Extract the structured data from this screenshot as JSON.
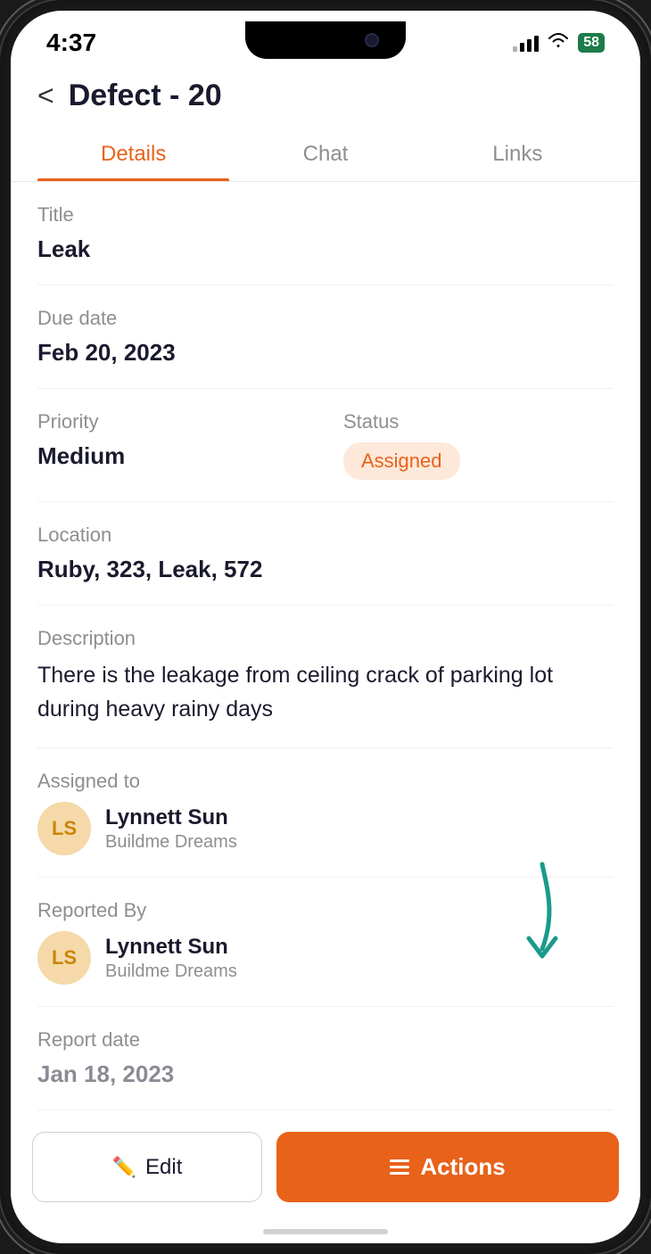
{
  "status_bar": {
    "time": "4:37",
    "battery": "58",
    "signal_bars": [
      6,
      10,
      14,
      18
    ],
    "signal_active": [
      false,
      true,
      true,
      true
    ]
  },
  "header": {
    "back_label": "<",
    "title": "Defect - 20"
  },
  "tabs": [
    {
      "id": "details",
      "label": "Details",
      "active": true
    },
    {
      "id": "chat",
      "label": "Chat",
      "active": false
    },
    {
      "id": "links",
      "label": "Links",
      "active": false
    }
  ],
  "fields": {
    "title_label": "Title",
    "title_value": "Leak",
    "due_date_label": "Due date",
    "due_date_value": "Feb 20, 2023",
    "priority_label": "Priority",
    "priority_value": "Medium",
    "status_label": "Status",
    "status_value": "Assigned",
    "location_label": "Location",
    "location_value": "Ruby, 323, Leak, 572",
    "description_label": "Description",
    "description_value": "There is the leakage from ceiling crack of parking lot during heavy rainy days",
    "assigned_to_label": "Assigned to",
    "assigned_to_name": "Lynnett Sun",
    "assigned_to_company": "Buildme Dreams",
    "assigned_to_initials": "LS",
    "reported_by_label": "Reported By",
    "reported_by_name": "Lynnett Sun",
    "reported_by_company": "Buildme Dreams",
    "reported_by_initials": "LS",
    "report_date_label": "Report date",
    "report_date_value": "Jan 18, 2023"
  },
  "buttons": {
    "edit_label": "Edit",
    "actions_label": "Actions"
  }
}
